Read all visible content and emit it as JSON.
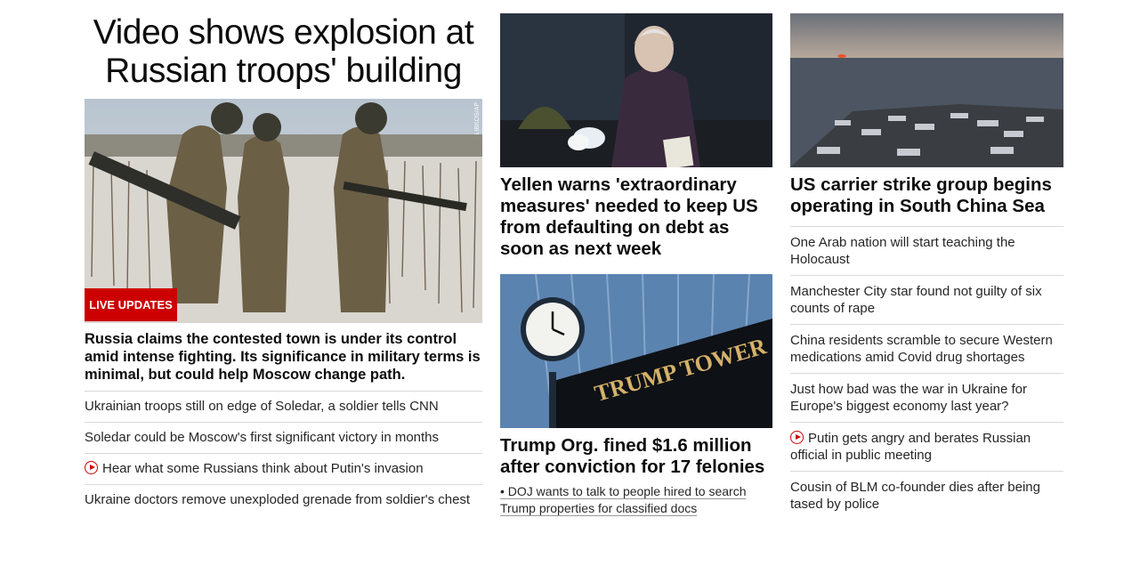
{
  "left": {
    "main_headline": "Video shows explosion at Russian troops' building",
    "image_credit": "LIBKOS/AP",
    "badge": "LIVE UPDATES",
    "summary": "Russia claims the contested town is under its control amid intense fighting. Its significance in military terms is minimal, but could help Moscow change path.",
    "links": [
      {
        "text": "Ukrainian troops still on edge of Soledar, a soldier tells CNN",
        "video": false
      },
      {
        "text": "Soledar could be Moscow's first significant victory in months",
        "video": false
      },
      {
        "text": "Hear what some Russians think about Putin's invasion",
        "video": true
      },
      {
        "text": "Ukraine doctors remove unexploded grenade from soldier's chest",
        "video": false
      }
    ]
  },
  "middle": {
    "story1_headline": "Yellen warns 'extraordinary measures' needed to keep US from defaulting on debt as soon as next week",
    "story2_headline": "Trump Org. fined $1.6 million after conviction for 17 felonies",
    "story2_image_sign": "TRUMP TOWER",
    "story2_sublink": "• DOJ wants to talk to people hired to search Trump properties for classified docs"
  },
  "right": {
    "headline": "US carrier strike group begins operating in South China Sea",
    "links": [
      {
        "text": "One Arab nation will start teaching the Holocaust",
        "video": false
      },
      {
        "text": "Manchester City star found not guilty of six counts of rape",
        "video": false
      },
      {
        "text": "China residents scramble to secure Western medications amid Covid drug shortages",
        "video": false
      },
      {
        "text": "Just how bad was the war in Ukraine for Europe's biggest economy last year?",
        "video": false
      },
      {
        "text": "Putin gets angry and berates Russian official in public meeting",
        "video": true
      },
      {
        "text": "Cousin of BLM co-founder dies after being tased by police",
        "video": false
      }
    ]
  },
  "colors": {
    "accent": "#cc0000",
    "divider": "#d9d9d9"
  }
}
